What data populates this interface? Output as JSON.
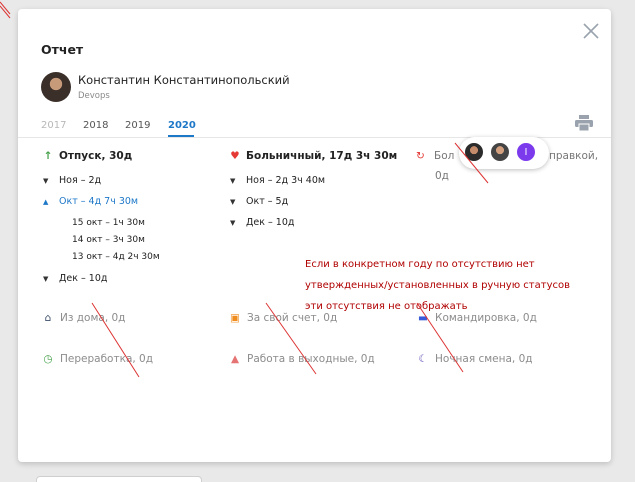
{
  "dialog": {
    "title": "Отчет",
    "user": {
      "name": "Константин Константинопольский",
      "role": "Devops"
    },
    "tabs": [
      {
        "label": "2017",
        "state": "disabled"
      },
      {
        "label": "2018",
        "state": "normal"
      },
      {
        "label": "2019",
        "state": "normal"
      },
      {
        "label": "2020",
        "state": "active"
      }
    ],
    "vacation": {
      "header": "Отпуск, 30д",
      "rows": [
        {
          "label": "Ноя – 2д",
          "open": false
        },
        {
          "label": "Окт – 4д 7ч 30м",
          "open": true
        },
        {
          "label": "Дек – 10д",
          "open": false
        }
      ],
      "details": [
        "15 окт – 1ч 30м",
        "14 окт – 3ч 30м",
        "13 окт – 4д 2ч 30м"
      ]
    },
    "sick": {
      "header": "Больничный, 17д 3ч 30м",
      "rows": [
        {
          "label": "Ноя – 2д 3ч 40м"
        },
        {
          "label": "Окт – 5д"
        },
        {
          "label": "Дек – 10д"
        }
      ]
    },
    "third": {
      "header_left": "Бол",
      "header_right": "правкой,",
      "line2": "0д"
    },
    "other_categories": [
      {
        "label": "Из дома, 0д",
        "icon": "home-icon"
      },
      {
        "label": "За свой счет, 0д",
        "icon": "calendar-icon"
      },
      {
        "label": "Командировка, 0д",
        "icon": "briefcase-icon"
      },
      {
        "label": "Переработка, 0д",
        "icon": "clock-icon"
      },
      {
        "label": "Работа в выходные, 0д",
        "icon": "person-icon"
      },
      {
        "label": "Ночная смена, 0д",
        "icon": "moon-icon"
      }
    ],
    "avatars_initial": "I"
  },
  "annotation": {
    "lines": [
      "Если в конкретном году по отсутствию нет",
      "утвержденных/установленных в ручную статусов",
      "эти отсутствия не отображать"
    ]
  },
  "colors": {
    "accent": "#1e78c8",
    "vacation_icon": "#43a047",
    "sick_icon": "#e53935",
    "home_icon": "#3d4f6b",
    "calendar_icon": "#f08c1e",
    "briefcase_icon": "#3a5bd9",
    "clock_icon": "#43a047",
    "person_icon": "#e57373",
    "moon_icon": "#5c4bb7",
    "annotation": "#b00000",
    "avatar_initial_bg": "#7c3aed"
  }
}
